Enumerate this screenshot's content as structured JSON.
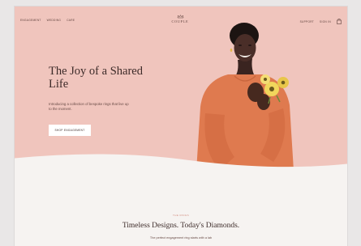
{
  "nav": {
    "left_links": [
      "Engagement",
      "Wedding",
      "Care"
    ],
    "right_links": [
      "Support",
      "Sign in"
    ],
    "logo_text": "COUPLE",
    "logo_icon": "crown-icon",
    "cart_icon": "shopping-bag-icon"
  },
  "hero": {
    "title": "The Joy of a Shared Life",
    "subtitle": "Introducing a collection of bespoke rings that live up to the moment.",
    "cta_label": "Shop Engagement",
    "background_color": "#f0c5bd",
    "image_subject": "woman in orange top holding yellow flowers"
  },
  "section": {
    "kicker": "The Rings",
    "title": "Timeless Designs. Today's Diamonds.",
    "subtitle": "The perfect engagement ring starts with a lab"
  },
  "colors": {
    "accent": "#d18a7c",
    "text_dark": "#3d2b29",
    "page_bg": "#f6f3f1"
  }
}
